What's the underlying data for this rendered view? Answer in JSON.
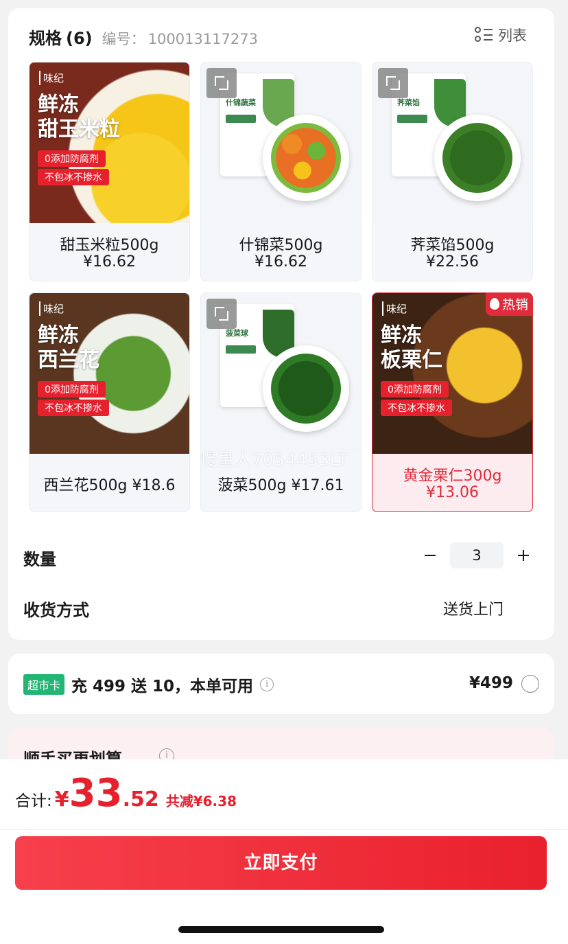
{
  "spec": {
    "title": "规格",
    "count": "(6)",
    "code_label": "编号：",
    "code_value": "100013117273",
    "list_toggle_label": "列表",
    "watermark": "慢星人7054453LT",
    "items": [
      {
        "name": "甜玉米粒500g",
        "price": "¥16.62",
        "promo_title_1": "鲜冻",
        "promo_title_2": "甜玉米粒",
        "tag1": "0添加防腐剂",
        "tag2": "不包冰不掺水",
        "brand": "味纪"
      },
      {
        "name": "什锦菜500g",
        "price": "¥16.62",
        "package_label": "什锦蔬菜"
      },
      {
        "name": "荠菜馅500g",
        "price": "¥22.56",
        "package_label": "荠菜馅"
      },
      {
        "name": "西兰花500g",
        "price": "¥18.6",
        "promo_title_1": "鲜冻",
        "promo_title_2": "西兰花",
        "tag1": "0添加防腐剂",
        "tag2": "不包冰不掺水",
        "brand": "味纪"
      },
      {
        "name": "菠菜500g",
        "price": "¥17.61",
        "package_label": "菠菜球"
      },
      {
        "name": "黄金栗仁300g",
        "price": "¥13.06",
        "promo_title_1": "鲜冻",
        "promo_title_2": "板栗仁",
        "tag1": "0添加防腐剂",
        "tag2": "不包冰不掺水",
        "brand": "味纪",
        "badge": "热销",
        "selected": true
      }
    ]
  },
  "quantity": {
    "label": "数量",
    "value": "3"
  },
  "delivery": {
    "label": "收货方式",
    "value": "送货上门"
  },
  "card_promo": {
    "badge": "超市卡",
    "text": "充 499 送 10，本单可用",
    "price": "¥499",
    "info_icon": "i"
  },
  "addon": {
    "title": "顺手买更划算",
    "info_icon": "i"
  },
  "footer": {
    "total_label": "合计:",
    "currency": "¥",
    "total_int": "33",
    "total_dec": ".52",
    "discount": "共减¥6.38",
    "pay_button": "立即支付"
  },
  "colors": {
    "accent": "#e5212e",
    "badge_green": "#22b573",
    "selected_bg": "#fdecef"
  },
  "icons": [
    "list-icon",
    "expand-icon",
    "flame-icon",
    "info-icon",
    "minus-icon",
    "plus-icon",
    "radio-icon"
  ]
}
